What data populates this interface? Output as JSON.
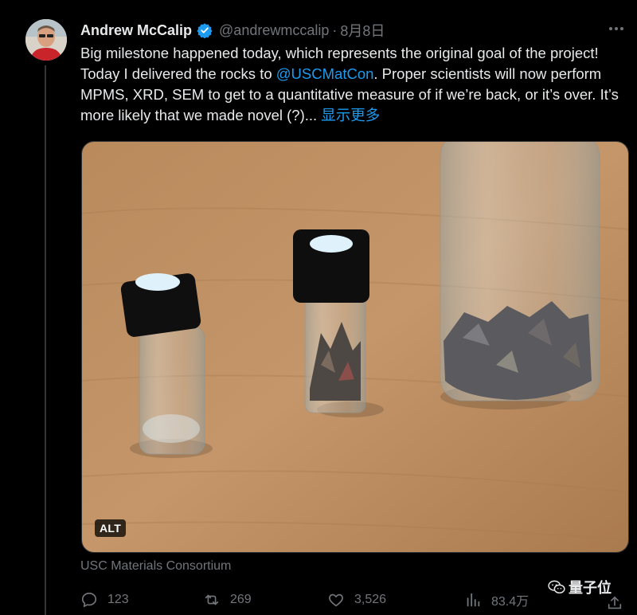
{
  "author": {
    "name": "Andrew McCalip",
    "handle": "@andrewmccalip",
    "separator": "·",
    "date": "8月8日"
  },
  "tweet": {
    "text_before_mention": "Big milestone happened today, which represents the original goal of the project! Today I delivered the rocks to ",
    "mention": "@USCMatCon",
    "text_after_mention": ". Proper scientists will now perform MPMS, XRD, SEM to get to a quantitative measure of if we’re back, or it’s over. It’s more likely that we made novel (?)...",
    "show_more": " 显示更多"
  },
  "media": {
    "alt_badge": "ALT",
    "source": "USC Materials Consortium"
  },
  "actions": {
    "replies": "123",
    "reposts": "269",
    "likes": "3,526",
    "views": "83.4万"
  },
  "watermark": {
    "text": "量子位"
  },
  "colors": {
    "background": "#000000",
    "accent": "#1d9bf0",
    "muted": "#71767b",
    "text": "#e7e9ea"
  }
}
